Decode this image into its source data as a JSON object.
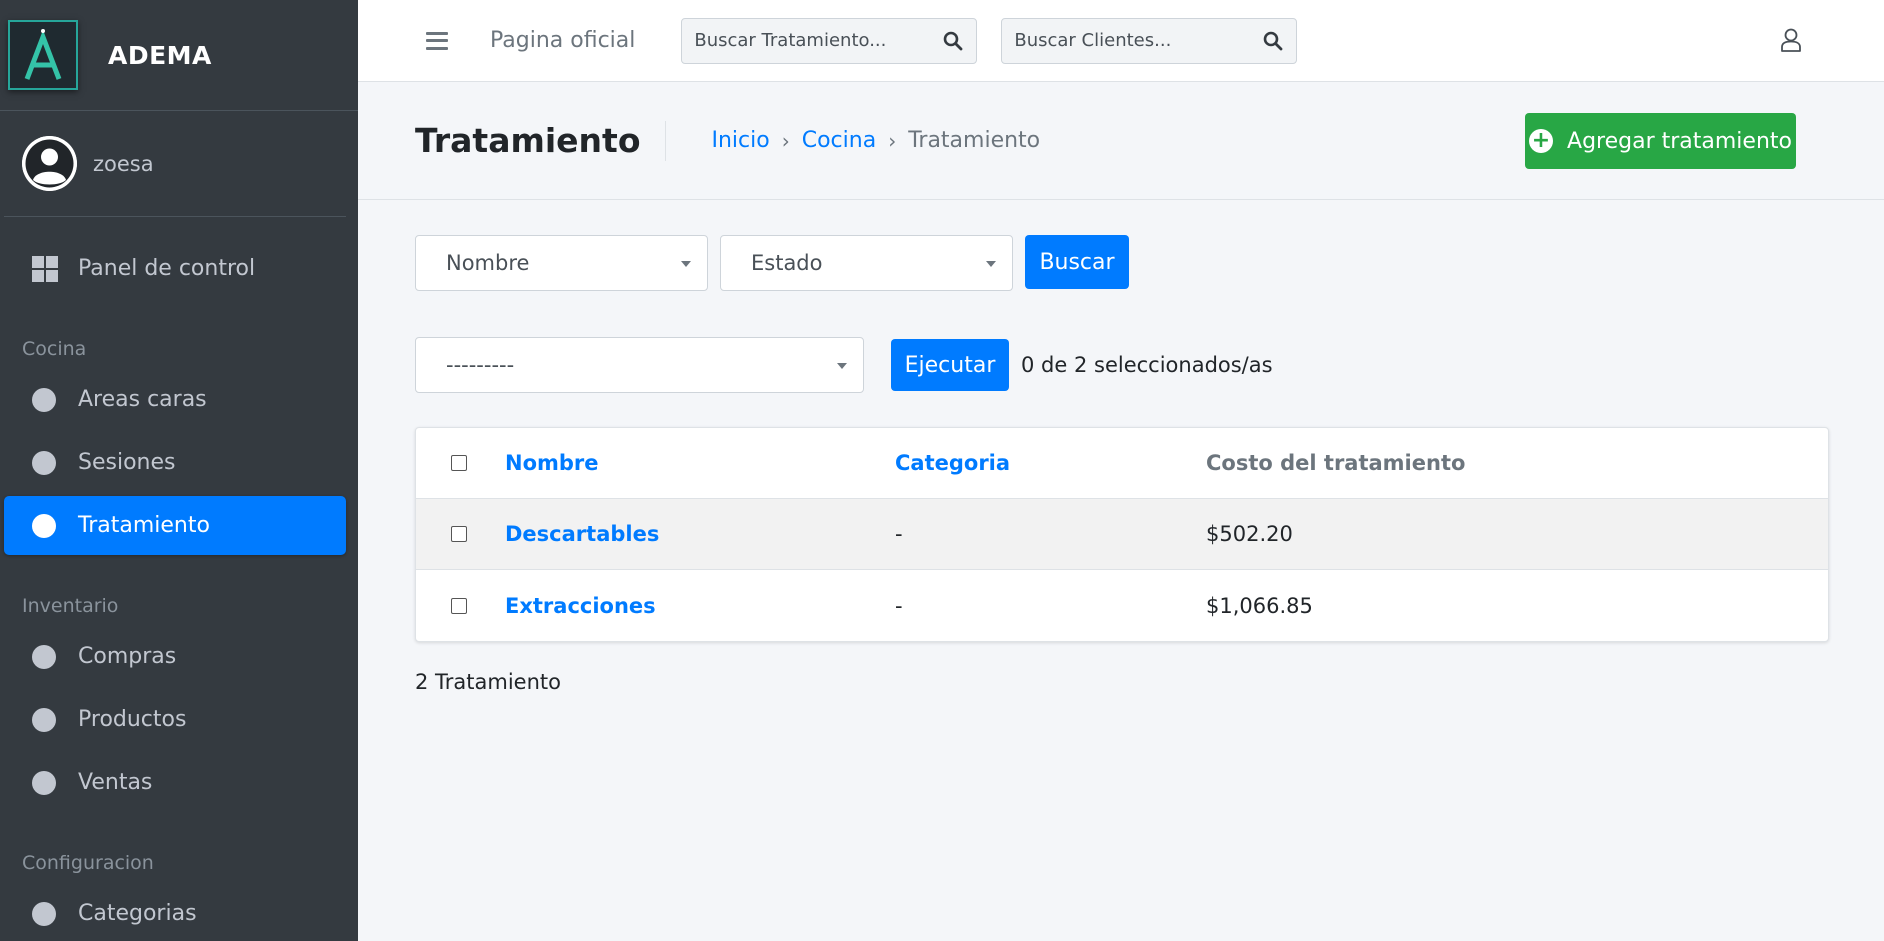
{
  "brand": {
    "logo_letter": "A",
    "name": "ADEMA"
  },
  "user": {
    "name": "zoesa"
  },
  "sidebar": {
    "dashboard": "Panel de control",
    "sections": [
      {
        "header": "Cocina",
        "items": [
          "Areas caras",
          "Sesiones",
          "Tratamiento"
        ]
      },
      {
        "header": "Inventario",
        "items": [
          "Compras",
          "Productos",
          "Ventas"
        ]
      },
      {
        "header": "Configuracion",
        "items": [
          "Categorias"
        ]
      }
    ],
    "active_item": "Tratamiento"
  },
  "topbar": {
    "link": "Pagina oficial",
    "search_treatment_placeholder": "Buscar Tratamiento...",
    "search_clients_placeholder": "Buscar Clientes..."
  },
  "header": {
    "title": "Tratamiento",
    "breadcrumb": [
      "Inicio",
      "Cocina",
      "Tratamiento"
    ],
    "add_button": "Agregar tratamiento"
  },
  "filters": {
    "name_select": "Nombre",
    "status_select": "Estado",
    "search_button": "Buscar"
  },
  "actions": {
    "action_select": "---------",
    "execute_button": "Ejecutar",
    "selected_counter": "0 de 2 seleccionados/as"
  },
  "table": {
    "columns": [
      "Nombre",
      "Categoria",
      "Costo del tratamiento"
    ],
    "rows": [
      {
        "name": "Descartables",
        "category": "-",
        "cost": "$502.20"
      },
      {
        "name": "Extracciones",
        "category": "-",
        "cost": "$1,066.85"
      }
    ]
  },
  "footer": {
    "count": "2 Tratamiento"
  },
  "colors": {
    "primary": "#007bff",
    "success": "#28a745",
    "sidebar": "#343a40"
  }
}
